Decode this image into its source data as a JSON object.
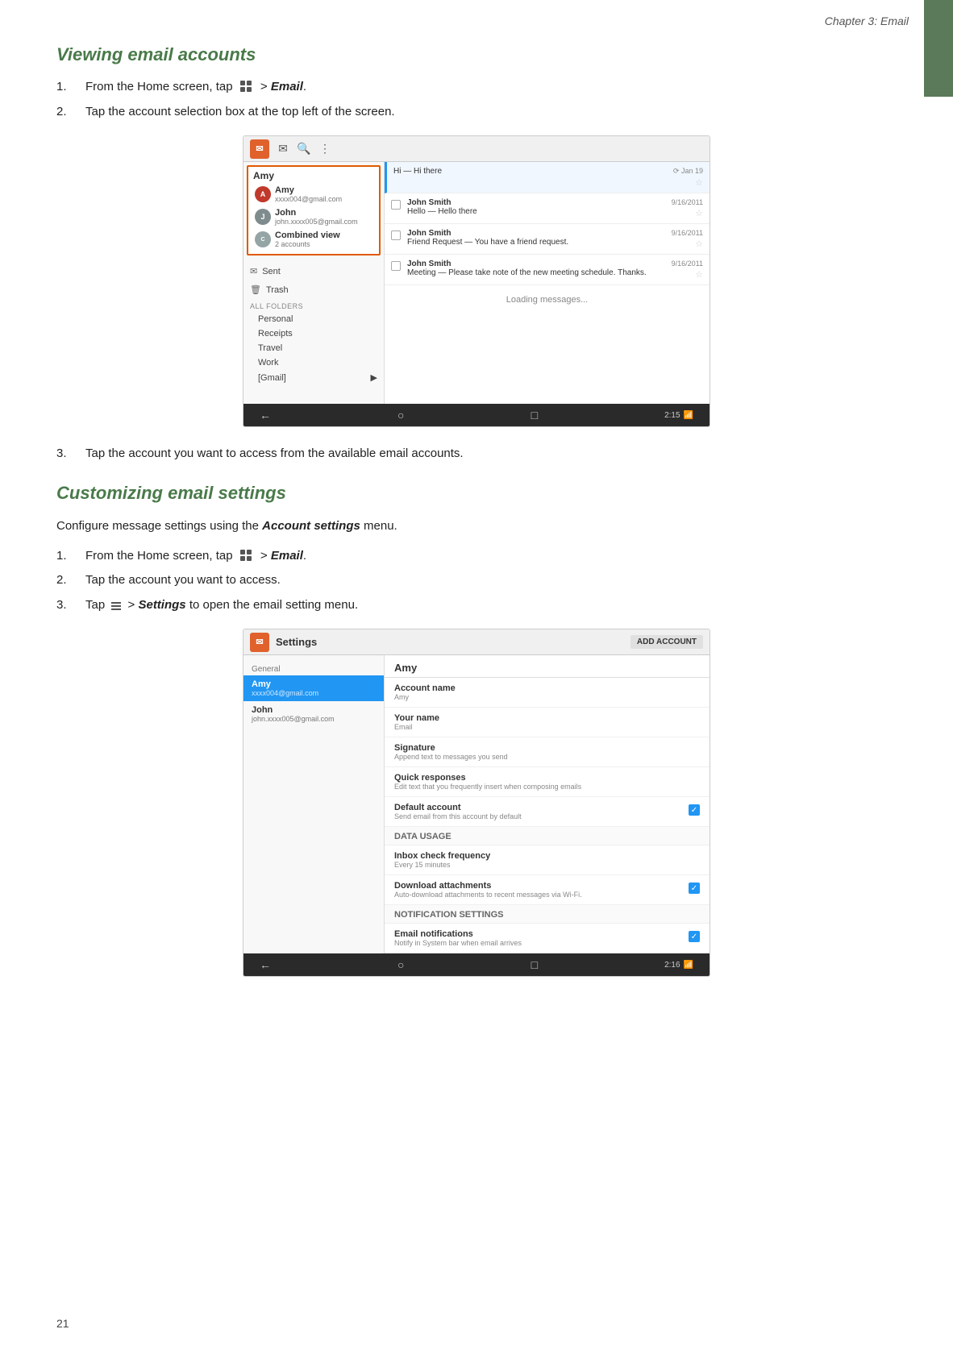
{
  "header": {
    "chapter": "Chapter 3: Email"
  },
  "section1": {
    "title": "Viewing email accounts",
    "steps": [
      {
        "num": "1.",
        "text_before": "From the Home screen, tap",
        "bold": "Email",
        "text_after": "."
      },
      {
        "num": "2.",
        "text": "Tap the account selection box at the top left of the screen."
      }
    ],
    "step3": {
      "num": "3.",
      "text": "Tap the account you want to access from the available email accounts."
    },
    "screenshot": {
      "accounts": [
        {
          "name": "Amy",
          "email": "xxxx004@gmail.com",
          "type": "amy"
        },
        {
          "name": "John",
          "email": "john.xxxx005@gmail.com",
          "type": "john"
        },
        {
          "name": "Combined view",
          "sub": "2 accounts",
          "type": "combined"
        }
      ],
      "sidebar": {
        "items": [
          "Sent",
          "Trash"
        ],
        "section": "ALL FOLDERS",
        "folders": [
          "Personal",
          "Receipts",
          "Travel",
          "Work",
          "[Gmail]"
        ]
      },
      "emails": [
        {
          "sender": "",
          "subject": "Hi — Hi there",
          "date": "Jan 19",
          "star": true,
          "preview": true
        },
        {
          "sender": "John Smith",
          "subject": "Hello — Hello there",
          "date": "9/16/2011",
          "star": true
        },
        {
          "sender": "John Smith",
          "subject": "Friend Request — You have a friend request.",
          "date": "9/16/2011",
          "star": true
        },
        {
          "sender": "John Smith",
          "subject": "Meeting — Please take note of the new meeting schedule. Thanks.",
          "date": "9/16/2011",
          "star": true
        }
      ],
      "loading": "Loading messages...",
      "time": "2:15"
    }
  },
  "section2": {
    "title": "Customizing email settings",
    "intro": {
      "text_before": "Configure message settings using the",
      "bold": "Account settings",
      "text_after": "menu."
    },
    "steps": [
      {
        "num": "1.",
        "text_before": "From the Home screen, tap",
        "bold": "Email",
        "text_after": "."
      },
      {
        "num": "2.",
        "text": "Tap the account you want to access."
      },
      {
        "num": "3.",
        "text_before": "Tap",
        "bold": "Settings",
        "text_after": "to open the email setting menu."
      }
    ],
    "screenshot": {
      "title": "Settings",
      "add_account": "ADD ACCOUNT",
      "section_general": "General",
      "accounts": [
        {
          "name": "Amy",
          "email": "xxxx004@gmail.com",
          "active": true
        },
        {
          "name": "John",
          "email": "john.xxxx005@gmail.com",
          "active": false
        }
      ],
      "right_header": "Amy",
      "settings_items": [
        {
          "label": "Account name",
          "value": "Amy",
          "has_checkbox": false
        },
        {
          "label": "Your name",
          "value": "Email",
          "has_checkbox": false
        },
        {
          "label": "Signature",
          "desc": "Append text to messages you send",
          "has_checkbox": false
        },
        {
          "label": "Quick responses",
          "desc": "Edit text that you frequently insert when composing emails",
          "has_checkbox": false
        },
        {
          "label": "Default account",
          "desc": "Send email from this account by default",
          "has_checkbox": true
        },
        {
          "section": "DATA USAGE"
        },
        {
          "label": "Inbox check frequency",
          "value": "Every 15 minutes",
          "has_checkbox": false
        },
        {
          "label": "Download attachments",
          "desc": "Auto-download attachments to recent messages via Wi-Fi.",
          "has_checkbox": true
        },
        {
          "section": "NOTIFICATION SETTINGS"
        },
        {
          "label": "Email notifications",
          "desc": "Notify in System bar when email arrives",
          "has_checkbox": true
        }
      ],
      "time": "2:16"
    }
  },
  "page_number": "21",
  "icons": {
    "grid": "⊞",
    "menu": "≡",
    "back": "←",
    "home": "○",
    "recent": "□",
    "search": "🔍",
    "compose": "✉",
    "more": "⋮",
    "star_filled": "★",
    "star_empty": "☆",
    "check": "✓",
    "arrow_down": "▼"
  }
}
